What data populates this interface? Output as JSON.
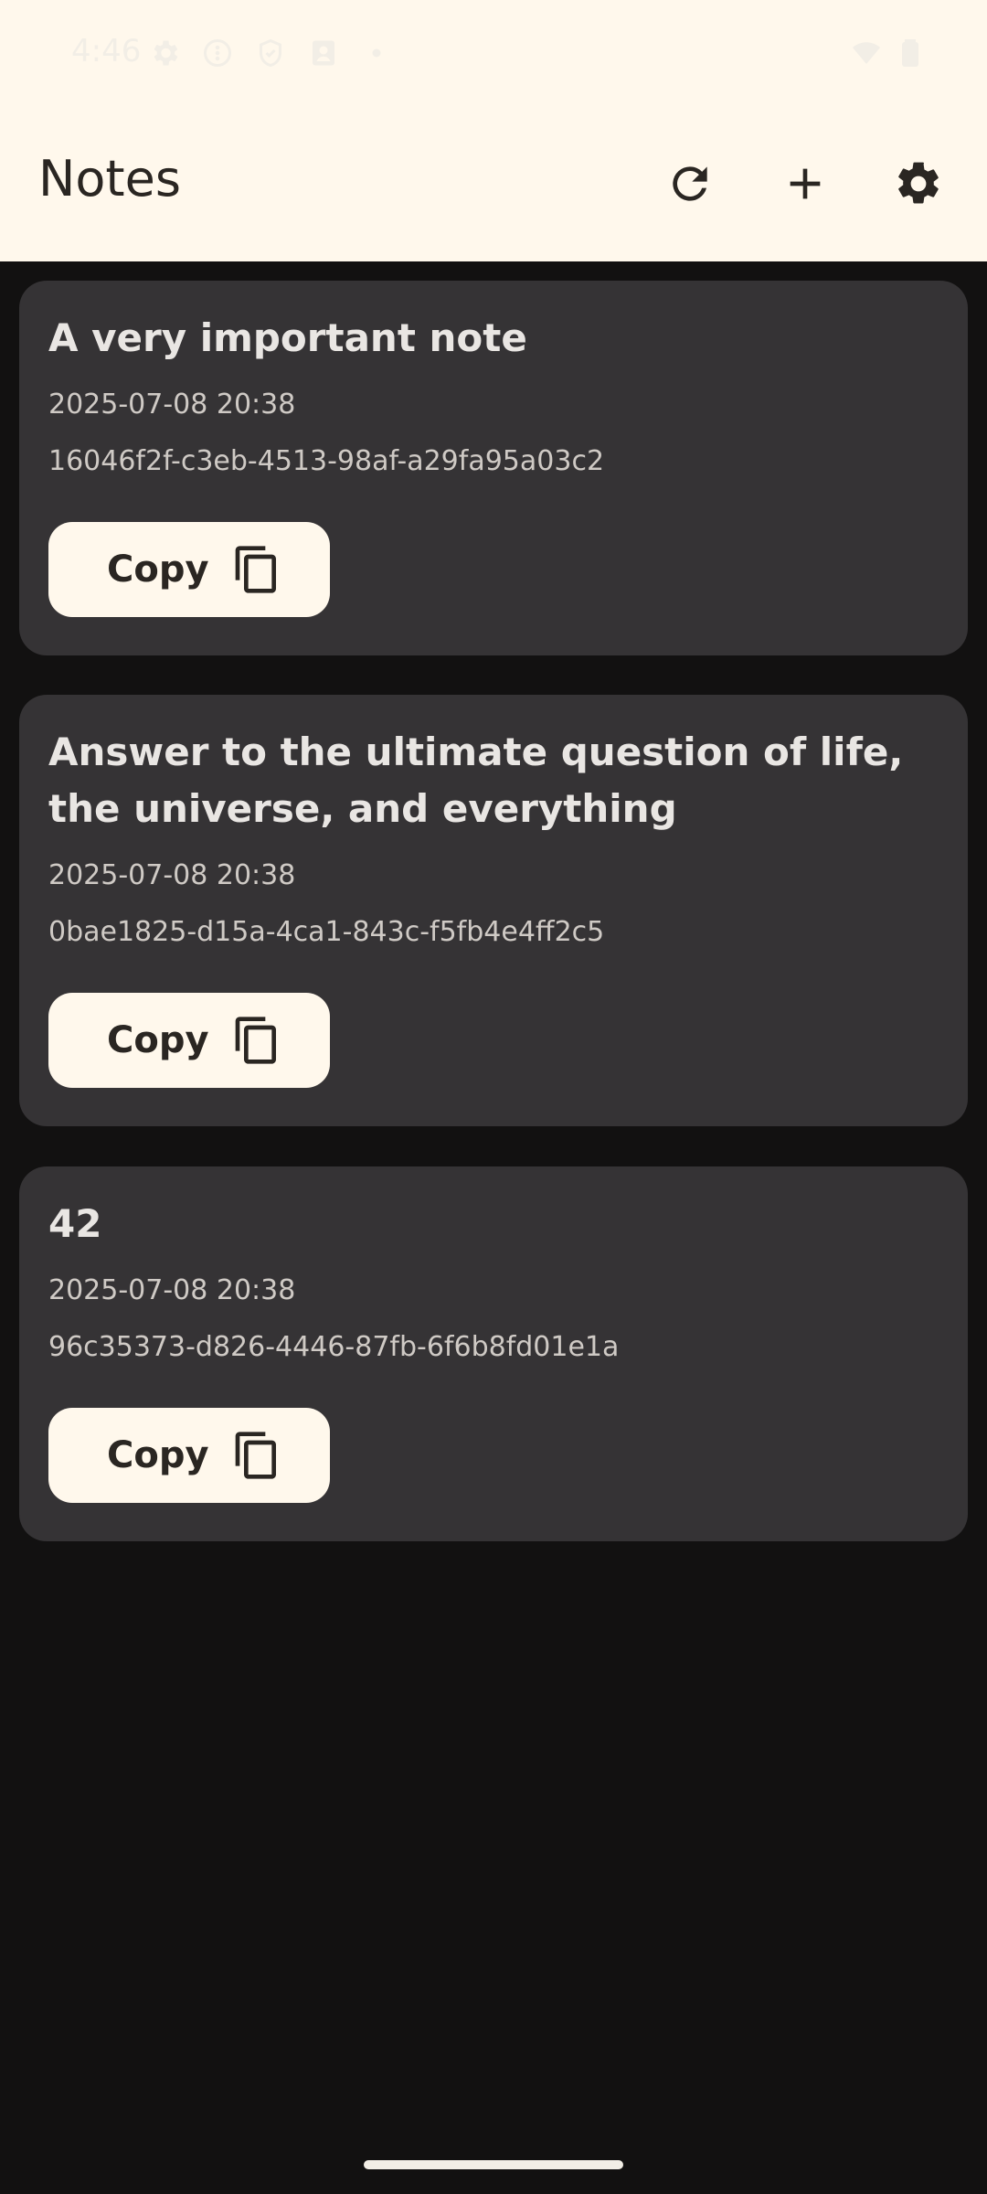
{
  "status_bar": {
    "time": "4:46",
    "icons": [
      "gear-icon",
      "circle-dots-icon",
      "shield-icon",
      "contact-icon",
      "dot-icon",
      "wifi-icon",
      "battery-icon"
    ]
  },
  "app_bar": {
    "title": "Notes",
    "actions": [
      "refresh-icon",
      "add-icon",
      "settings-icon"
    ]
  },
  "notes": [
    {
      "title": "A very important note",
      "date": "2025-07-08 20:38",
      "id": "16046f2f-c3eb-4513-98af-a29fa95a03c2",
      "copy_label": "Copy"
    },
    {
      "title": "Answer to the ultimate question of life, the universe, and everything",
      "date": "2025-07-08 20:38",
      "id": "0bae1825-d15a-4ca1-843c-f5fb4e4ff2c5",
      "copy_label": "Copy"
    },
    {
      "title": "42",
      "date": "2025-07-08 20:38",
      "id": "96c35373-d826-4446-87fb-6f6b8fd01e1a",
      "copy_label": "Copy"
    }
  ],
  "colors": {
    "app_bar_bg": "#FFF8EC",
    "screen_bg": "#121111",
    "card_bg": "#353335",
    "button_bg": "#FFF8EC",
    "title_text": "#E9E6E3",
    "meta_text": "#CFCAC5",
    "dark_text": "#2A2622"
  }
}
